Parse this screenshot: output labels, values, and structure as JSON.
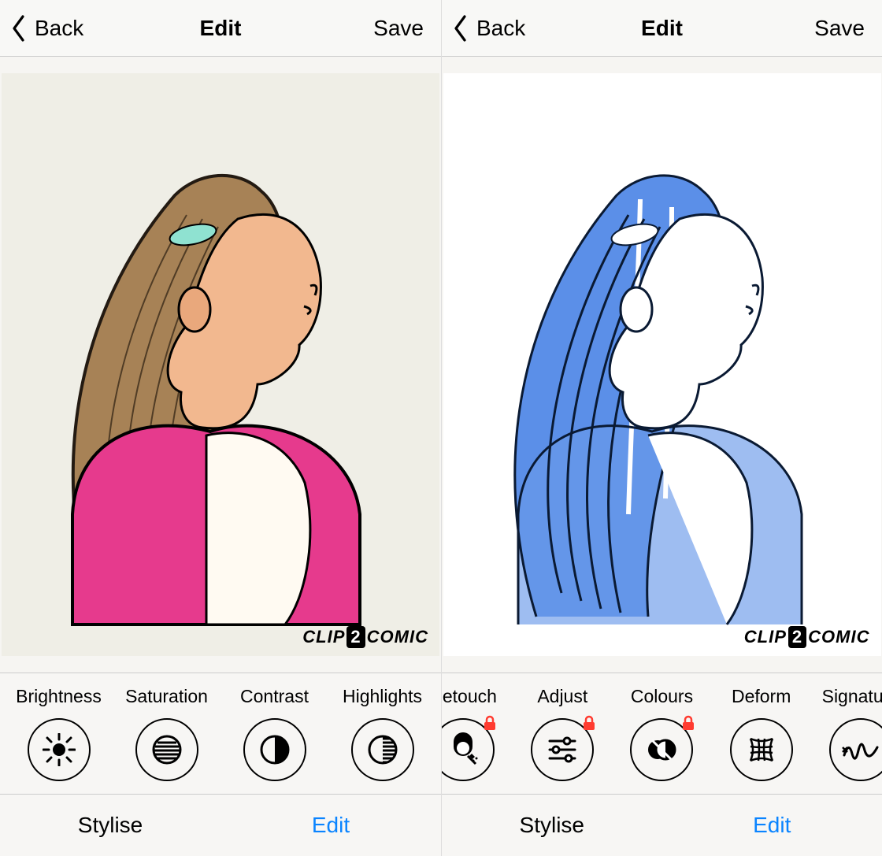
{
  "left": {
    "topbar": {
      "back": "Back",
      "title": "Edit",
      "save": "Save"
    },
    "watermark": {
      "a": "CLIP",
      "b": "2",
      "c": "COMIC"
    },
    "tools": [
      {
        "name": "brightness",
        "label": "Brightness",
        "locked": false
      },
      {
        "name": "saturation",
        "label": "Saturation",
        "locked": false
      },
      {
        "name": "contrast",
        "label": "Contrast",
        "locked": false
      },
      {
        "name": "highlights",
        "label": "Highlights",
        "locked": false
      }
    ],
    "tabs": {
      "stylise": "Stylise",
      "edit": "Edit",
      "active": "edit"
    }
  },
  "right": {
    "topbar": {
      "back": "Back",
      "title": "Edit",
      "save": "Save"
    },
    "watermark": {
      "a": "CLIP",
      "b": "2",
      "c": "COMIC"
    },
    "tools": [
      {
        "name": "retouch",
        "label": "Retouch",
        "locked": true
      },
      {
        "name": "adjust",
        "label": "Adjust",
        "locked": true
      },
      {
        "name": "colours",
        "label": "Colours",
        "locked": true
      },
      {
        "name": "deform",
        "label": "Deform",
        "locked": false
      },
      {
        "name": "signature",
        "label": "Signature",
        "locked": true
      }
    ],
    "tabs": {
      "stylise": "Stylise",
      "edit": "Edit",
      "active": "edit"
    }
  }
}
